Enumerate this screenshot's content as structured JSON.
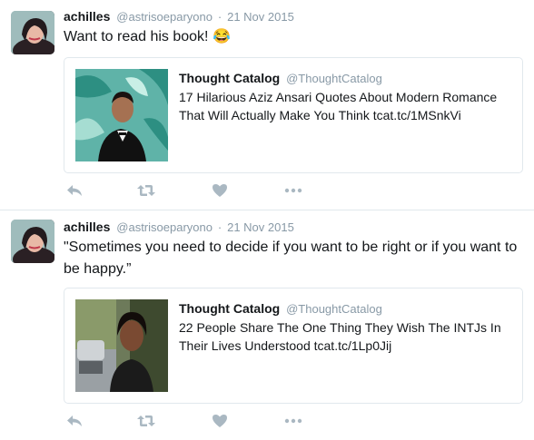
{
  "colors": {
    "text": "#14171a",
    "muted": "#8899a6",
    "border": "#e1e8ed",
    "icon": "#aab8c2"
  },
  "tweets": [
    {
      "name": "achilles",
      "handle": "@astrisoeparyono",
      "separator": "·",
      "date": "21 Nov 2015",
      "text": "Want to read his book! 😂",
      "card": {
        "name": "Thought Catalog",
        "handle": "@ThoughtCatalog",
        "text": "17 Hilarious Aziz Ansari Quotes About Modern Romance That Will Actually Make You Think tcat.tc/1MSnkVi"
      },
      "actions": [
        "reply-icon",
        "retweet-icon",
        "like-icon",
        "more-icon"
      ]
    },
    {
      "name": "achilles",
      "handle": "@astrisoeparyono",
      "separator": "·",
      "date": "21 Nov 2015",
      "text": "\"Sometimes you need to decide if you want to be right or if you want to be happy.”",
      "card": {
        "name": "Thought Catalog",
        "handle": "@ThoughtCatalog",
        "text": "22 People Share The One Thing They Wish The INTJs In Their Lives Understood tcat.tc/1Lp0Jij"
      },
      "actions": [
        "reply-icon",
        "retweet-icon",
        "like-icon",
        "more-icon"
      ]
    }
  ]
}
